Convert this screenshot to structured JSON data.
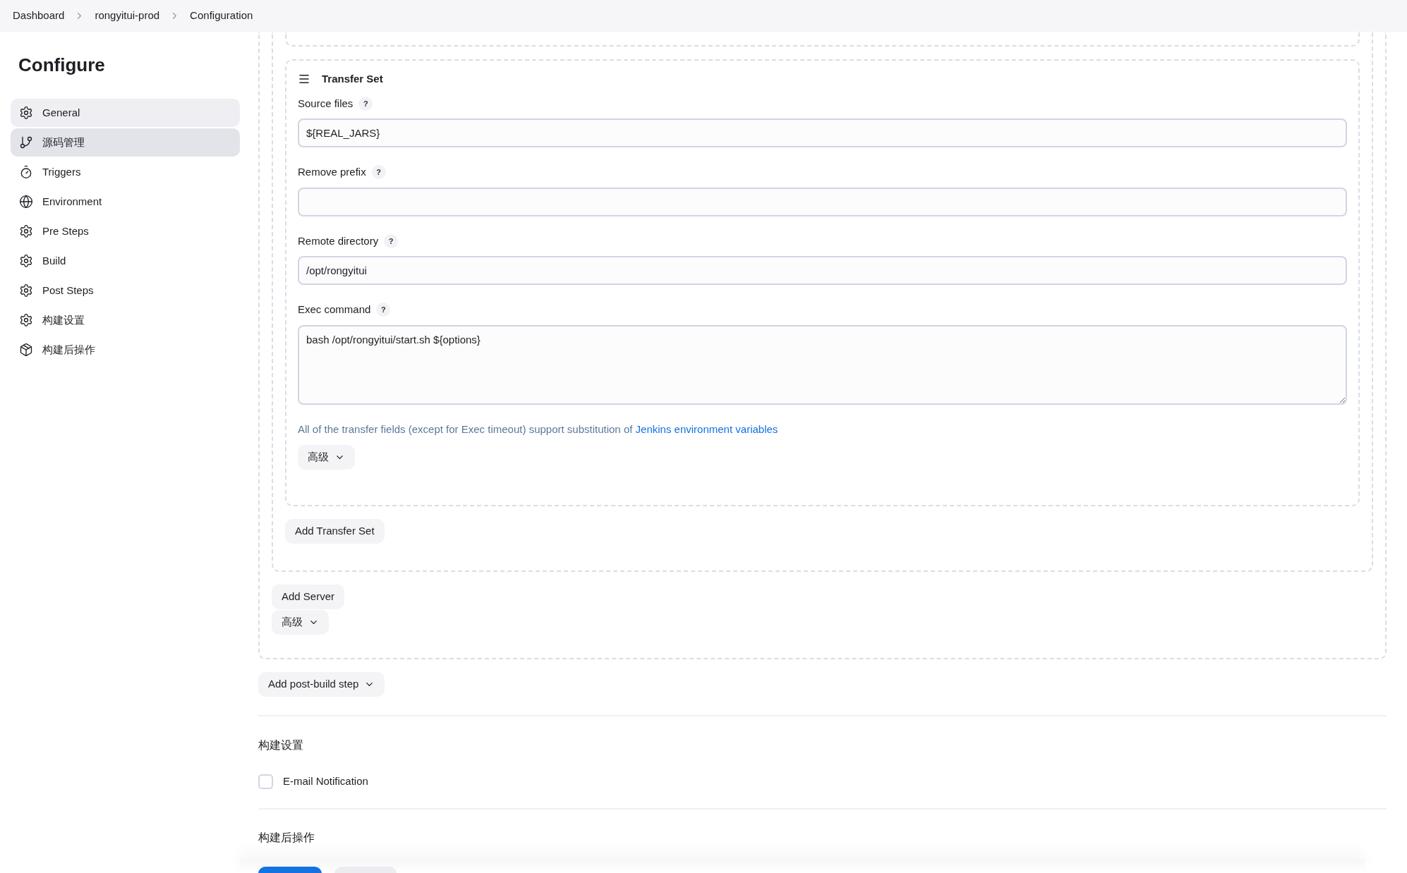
{
  "breadcrumbs": [
    {
      "label": "Dashboard"
    },
    {
      "label": "rongyitui-prod"
    },
    {
      "label": "Configuration"
    }
  ],
  "sidebar": {
    "title": "Configure",
    "items": [
      {
        "label": "General",
        "kind": "gear",
        "selected": false,
        "hovered": true
      },
      {
        "label": "源码管理",
        "kind": "branch",
        "selected": true,
        "hovered": false
      },
      {
        "label": "Triggers",
        "kind": "timer",
        "selected": false,
        "hovered": false
      },
      {
        "label": "Environment",
        "kind": "globe",
        "selected": false,
        "hovered": false
      },
      {
        "label": "Pre Steps",
        "kind": "gear",
        "selected": false,
        "hovered": false
      },
      {
        "label": "Build",
        "kind": "gear",
        "selected": false,
        "hovered": false
      },
      {
        "label": "Post Steps",
        "kind": "gear",
        "selected": false,
        "hovered": false
      },
      {
        "label": "构建设置",
        "kind": "gear",
        "selected": false,
        "hovered": false
      },
      {
        "label": "构建后操作",
        "kind": "package",
        "selected": false,
        "hovered": false
      }
    ]
  },
  "transfer_set": {
    "title": "Transfer Set",
    "fields": [
      {
        "kind": "input",
        "label": "Source files",
        "help": "?",
        "value": "${REAL_JARS}"
      },
      {
        "kind": "input",
        "label": "Remove prefix",
        "help": "?"
      },
      {
        "kind": "input",
        "label": "Remote directory",
        "help": "?",
        "value": "/opt/rongyitui"
      },
      {
        "kind": "textarea",
        "label": "Exec command",
        "help": "?",
        "value": "bash /opt/rongyitui/start.sh ${options}"
      }
    ],
    "note": "All of the transfer fields (except for Exec timeout) support substitution of",
    "note_link": "Jenkins environment variables",
    "advanced_button": "高级"
  },
  "add_transfer_set_button": "Add Transfer Set",
  "add_server_button": "Add Server",
  "server_advanced_button": "高级",
  "add_post_build_step_button": "Add post-build step",
  "build_settings": {
    "heading": "构建设置",
    "checkbox": {
      "label": "E-mail Notification",
      "checked": false
    }
  },
  "post_build_heading": "构建后操作"
}
